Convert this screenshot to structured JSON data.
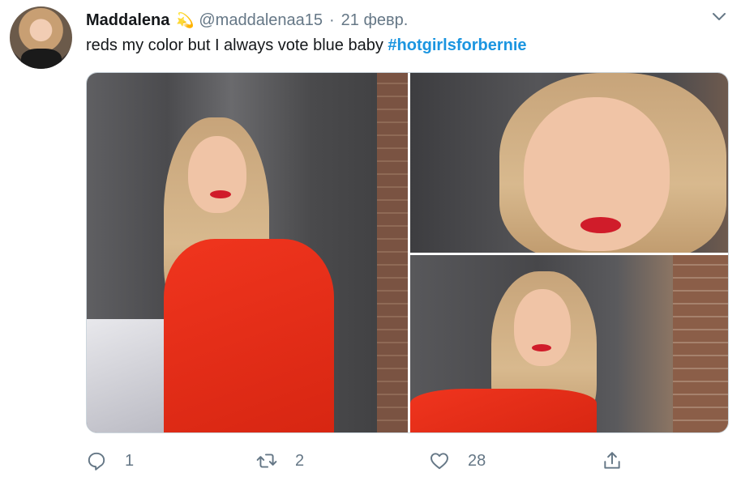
{
  "tweet": {
    "author_name": "Maddalena",
    "author_emoji": "💫",
    "handle": "@maddalenaa15",
    "separator": "·",
    "date": "21 февр.",
    "text": "reds my color but I always vote blue baby ",
    "hashtag": "#hotgirlsforbernie"
  },
  "actions": {
    "reply_count": "1",
    "retweet_count": "2",
    "like_count": "28"
  },
  "icons": {
    "menu": "chevron-down-icon",
    "reply": "reply-icon",
    "retweet": "retweet-icon",
    "like": "heart-icon",
    "share": "share-icon"
  },
  "colors": {
    "hashtag": "#1b95e0",
    "secondary_text": "#657786",
    "primary_text": "#14171a"
  }
}
